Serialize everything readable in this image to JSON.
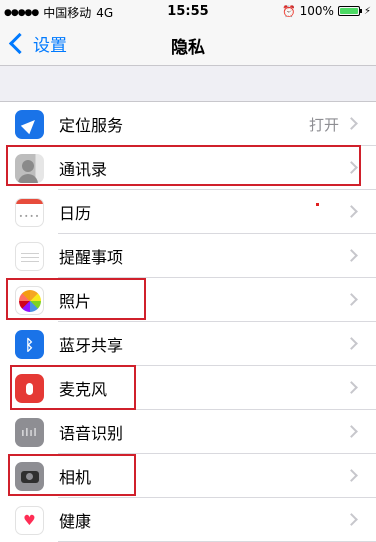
{
  "status_bar": {
    "signal": "●●●●●",
    "carrier": "中国移动",
    "network": "4G",
    "time": "15:55",
    "alarm_icon": "⏰",
    "battery_text": "100%",
    "battery_level": 1.0,
    "charging_icon": "⚡"
  },
  "nav": {
    "back_label": "设置",
    "title": "隐私"
  },
  "rows": [
    {
      "label": "定位服务",
      "value": "打开",
      "icon": "location-icon"
    },
    {
      "label": "通讯录",
      "icon": "contacts-icon"
    },
    {
      "label": "日历",
      "icon": "calendar-icon"
    },
    {
      "label": "提醒事项",
      "icon": "reminders-icon"
    },
    {
      "label": "照片",
      "icon": "photos-icon"
    },
    {
      "label": "蓝牙共享",
      "icon": "bluetooth-icon"
    },
    {
      "label": "麦克风",
      "icon": "microphone-icon"
    },
    {
      "label": "语音识别",
      "icon": "speech-recognition-icon"
    },
    {
      "label": "相机",
      "icon": "camera-icon"
    },
    {
      "label": "健康",
      "icon": "health-icon"
    }
  ],
  "icons": {
    "bluetooth": "ᛒ",
    "speech": "ılıl",
    "health": "♥"
  },
  "colors": {
    "accent": "#007aff",
    "highlight": "#d0202b"
  }
}
